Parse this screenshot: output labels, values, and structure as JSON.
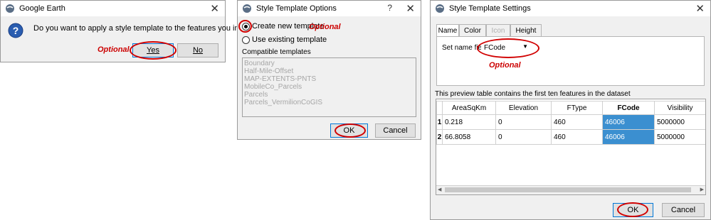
{
  "dialog1": {
    "title": "Google Earth",
    "message": "Do you want to apply a style template to the features you ingested?",
    "optional_label": "Optional",
    "yes_label": "Yes",
    "no_label": "No",
    "icon": "question-icon"
  },
  "dialog2": {
    "title": "Style Template Options",
    "help": "?",
    "create_new_label": "Create new template",
    "use_existing_label": "Use existing template",
    "optional_label": "Optional",
    "compatible_label": "Compatible templates",
    "templates": [
      "Boundary",
      "Half-Mile-Offset",
      "MAP-EXTENTS-PNTS",
      "MobileCo_Parcels",
      "Parcels",
      "Parcels_VermilionCoGIS"
    ],
    "ok_label": "OK",
    "cancel_label": "Cancel"
  },
  "dialog3": {
    "title": "Style Template Settings",
    "tabs": [
      "Name",
      "Color",
      "Icon",
      "Height"
    ],
    "set_name_label": "Set name field:",
    "name_field_value": "FCode",
    "optional_label": "Optional",
    "preview_text": "This preview table contains the first ten features in the dataset",
    "columns": [
      "AreaSqKm",
      "Elevation",
      "FType",
      "FCode",
      "Visibility"
    ],
    "rows": [
      {
        "num": "1",
        "cells": [
          "0.218",
          "0",
          "460",
          "46006",
          "5000000"
        ]
      },
      {
        "num": "2",
        "cells": [
          "66.8058",
          "0",
          "460",
          "46006",
          "5000000"
        ]
      }
    ],
    "ok_label": "OK",
    "cancel_label": "Cancel"
  },
  "colors": {
    "annotation_red": "#cc0000",
    "selection_blue": "#3b8fd0"
  }
}
